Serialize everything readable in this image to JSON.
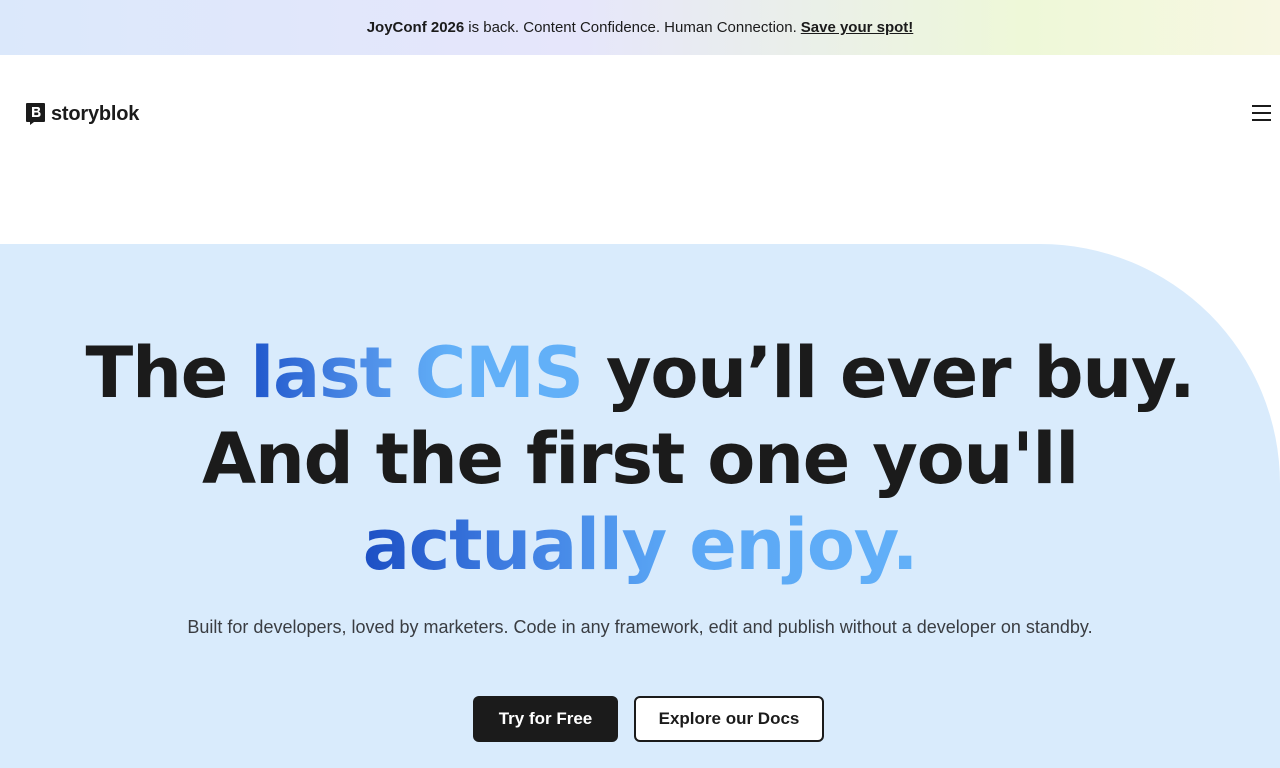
{
  "announcement": {
    "event": "JoyConf 2026",
    "message": "is back. Content Confidence. Human Connection.",
    "cta": "Save your spot!"
  },
  "nav": {
    "logo_text": "storyblok",
    "menu_icon": "hamburger-menu-icon"
  },
  "hero": {
    "headline": {
      "line1_a": "The",
      "line1_highlight": "last CMS",
      "line1_b": "you’ll ever buy.",
      "line2": "And the first one you'll",
      "line3_highlight": "actually enjoy."
    },
    "subtitle": "Built for developers, loved by marketers. Code in any framework, edit and publish without a developer on standby.",
    "primary_cta": "Try for Free",
    "secondary_cta": "Explore our Docs"
  },
  "colors": {
    "hero_bg": "#d9ebfc",
    "text": "#1b1b1b",
    "accent_dark": "#2057cc",
    "accent_light": "#62b0f8"
  }
}
